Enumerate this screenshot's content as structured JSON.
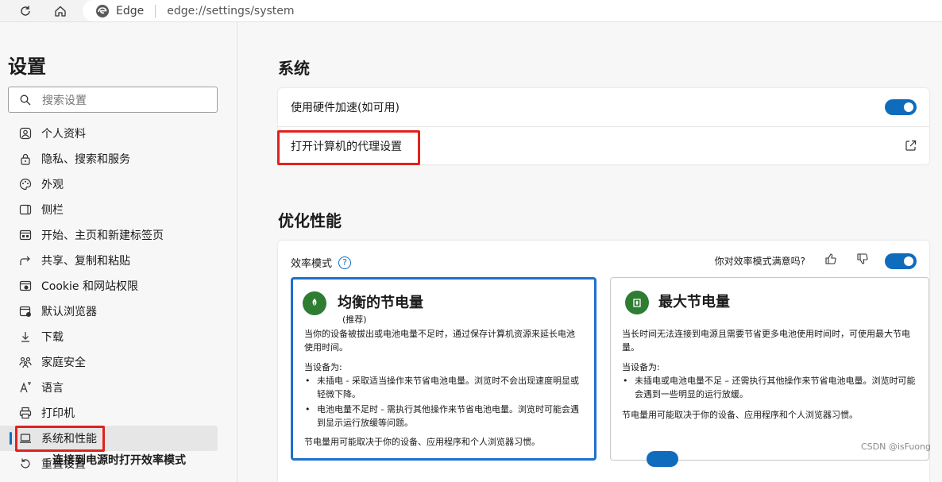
{
  "browser": {
    "brand": "Edge",
    "url": "edge://settings/system"
  },
  "sidebar": {
    "title": "设置",
    "search_placeholder": "搜索设置",
    "items": [
      {
        "label": "个人资料",
        "icon": "profile-icon"
      },
      {
        "label": "隐私、搜索和服务",
        "icon": "lock-icon"
      },
      {
        "label": "外观",
        "icon": "appearance-icon"
      },
      {
        "label": "侧栏",
        "icon": "sidebar-icon"
      },
      {
        "label": "开始、主页和新建标签页",
        "icon": "home-tab-icon"
      },
      {
        "label": "共享、复制和粘贴",
        "icon": "share-icon"
      },
      {
        "label": "Cookie 和网站权限",
        "icon": "cookie-icon"
      },
      {
        "label": "默认浏览器",
        "icon": "browser-icon"
      },
      {
        "label": "下载",
        "icon": "download-icon"
      },
      {
        "label": "家庭安全",
        "icon": "family-icon"
      },
      {
        "label": "语言",
        "icon": "language-icon"
      },
      {
        "label": "打印机",
        "icon": "printer-icon"
      },
      {
        "label": "系统和性能",
        "icon": "laptop-icon",
        "active": true
      },
      {
        "label": "重置设置",
        "icon": "reset-icon"
      }
    ]
  },
  "system": {
    "heading": "系统",
    "hardware_accel": {
      "label": "使用硬件加速(如可用)",
      "on": true
    },
    "proxy": {
      "label": "打开计算机的代理设置"
    }
  },
  "performance": {
    "heading": "优化性能",
    "efficiency_label": "效率模式",
    "satisfaction_question": "你对效率模式满意吗?",
    "efficiency_on": true,
    "modes": [
      {
        "title": "均衡的节电量",
        "subtitle": "(推荐)",
        "selected": true,
        "description": "当你的设备被拔出或电池电量不足时，通过保存计算机资源来延长电池使用时间。",
        "when": "当设备为:",
        "bullets": [
          "未插电 - 采取适当操作来节省电池电量。浏览时不会出现速度明显或轻微下降。",
          "电池电量不足时 - 需执行其他操作来节省电池电量。浏览时可能会遇到显示运行放缓等问题。"
        ],
        "footer": "节电量用可能取决于你的设备、应用程序和个人浏览器习惯。"
      },
      {
        "title": "最大节电量",
        "subtitle": "",
        "selected": false,
        "description": "当长时间无法连接到电源且需要节省更多电池使用时间时，可使用最大节电量。",
        "when": "当设备为:",
        "bullets": [
          "未插电或电池电量不足 – 还需执行其他操作来节省电池电量。浏览时可能会遇到一些明显的运行放缓。"
        ],
        "footer": "节电量用可能取决于你的设备、应用程序和个人浏览器习惯。"
      }
    ],
    "next_row_label": "连接到电源时打开效率模式"
  },
  "watermark": "CSDN @isFuong",
  "colors": {
    "accent": "#0f6cbd",
    "highlight": "#e0221e",
    "leaf": "#2e7d32"
  }
}
